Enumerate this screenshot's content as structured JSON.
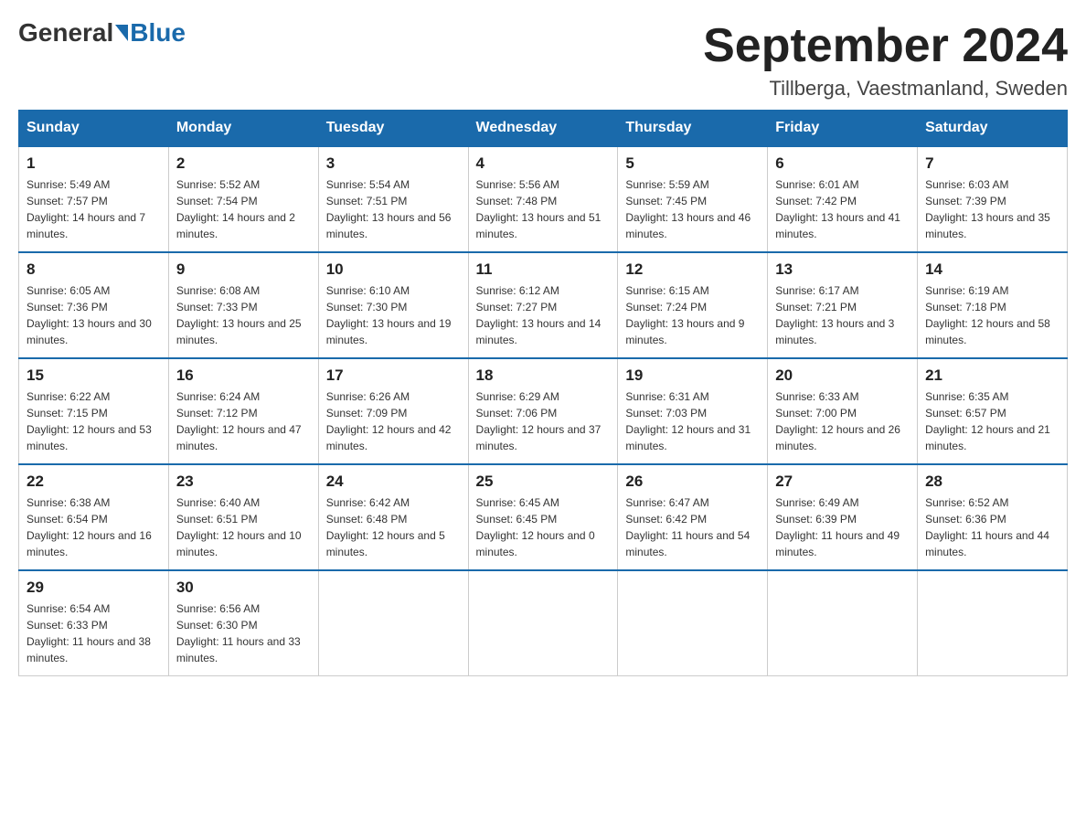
{
  "header": {
    "logo_general": "General",
    "logo_blue": "Blue",
    "month_title": "September 2024",
    "location": "Tillberga, Vaestmanland, Sweden"
  },
  "days_of_week": [
    "Sunday",
    "Monday",
    "Tuesday",
    "Wednesday",
    "Thursday",
    "Friday",
    "Saturday"
  ],
  "weeks": [
    [
      {
        "day": "1",
        "sunrise": "5:49 AM",
        "sunset": "7:57 PM",
        "daylight": "14 hours and 7 minutes."
      },
      {
        "day": "2",
        "sunrise": "5:52 AM",
        "sunset": "7:54 PM",
        "daylight": "14 hours and 2 minutes."
      },
      {
        "day": "3",
        "sunrise": "5:54 AM",
        "sunset": "7:51 PM",
        "daylight": "13 hours and 56 minutes."
      },
      {
        "day": "4",
        "sunrise": "5:56 AM",
        "sunset": "7:48 PM",
        "daylight": "13 hours and 51 minutes."
      },
      {
        "day": "5",
        "sunrise": "5:59 AM",
        "sunset": "7:45 PM",
        "daylight": "13 hours and 46 minutes."
      },
      {
        "day": "6",
        "sunrise": "6:01 AM",
        "sunset": "7:42 PM",
        "daylight": "13 hours and 41 minutes."
      },
      {
        "day": "7",
        "sunrise": "6:03 AM",
        "sunset": "7:39 PM",
        "daylight": "13 hours and 35 minutes."
      }
    ],
    [
      {
        "day": "8",
        "sunrise": "6:05 AM",
        "sunset": "7:36 PM",
        "daylight": "13 hours and 30 minutes."
      },
      {
        "day": "9",
        "sunrise": "6:08 AM",
        "sunset": "7:33 PM",
        "daylight": "13 hours and 25 minutes."
      },
      {
        "day": "10",
        "sunrise": "6:10 AM",
        "sunset": "7:30 PM",
        "daylight": "13 hours and 19 minutes."
      },
      {
        "day": "11",
        "sunrise": "6:12 AM",
        "sunset": "7:27 PM",
        "daylight": "13 hours and 14 minutes."
      },
      {
        "day": "12",
        "sunrise": "6:15 AM",
        "sunset": "7:24 PM",
        "daylight": "13 hours and 9 minutes."
      },
      {
        "day": "13",
        "sunrise": "6:17 AM",
        "sunset": "7:21 PM",
        "daylight": "13 hours and 3 minutes."
      },
      {
        "day": "14",
        "sunrise": "6:19 AM",
        "sunset": "7:18 PM",
        "daylight": "12 hours and 58 minutes."
      }
    ],
    [
      {
        "day": "15",
        "sunrise": "6:22 AM",
        "sunset": "7:15 PM",
        "daylight": "12 hours and 53 minutes."
      },
      {
        "day": "16",
        "sunrise": "6:24 AM",
        "sunset": "7:12 PM",
        "daylight": "12 hours and 47 minutes."
      },
      {
        "day": "17",
        "sunrise": "6:26 AM",
        "sunset": "7:09 PM",
        "daylight": "12 hours and 42 minutes."
      },
      {
        "day": "18",
        "sunrise": "6:29 AM",
        "sunset": "7:06 PM",
        "daylight": "12 hours and 37 minutes."
      },
      {
        "day": "19",
        "sunrise": "6:31 AM",
        "sunset": "7:03 PM",
        "daylight": "12 hours and 31 minutes."
      },
      {
        "day": "20",
        "sunrise": "6:33 AM",
        "sunset": "7:00 PM",
        "daylight": "12 hours and 26 minutes."
      },
      {
        "day": "21",
        "sunrise": "6:35 AM",
        "sunset": "6:57 PM",
        "daylight": "12 hours and 21 minutes."
      }
    ],
    [
      {
        "day": "22",
        "sunrise": "6:38 AM",
        "sunset": "6:54 PM",
        "daylight": "12 hours and 16 minutes."
      },
      {
        "day": "23",
        "sunrise": "6:40 AM",
        "sunset": "6:51 PM",
        "daylight": "12 hours and 10 minutes."
      },
      {
        "day": "24",
        "sunrise": "6:42 AM",
        "sunset": "6:48 PM",
        "daylight": "12 hours and 5 minutes."
      },
      {
        "day": "25",
        "sunrise": "6:45 AM",
        "sunset": "6:45 PM",
        "daylight": "12 hours and 0 minutes."
      },
      {
        "day": "26",
        "sunrise": "6:47 AM",
        "sunset": "6:42 PM",
        "daylight": "11 hours and 54 minutes."
      },
      {
        "day": "27",
        "sunrise": "6:49 AM",
        "sunset": "6:39 PM",
        "daylight": "11 hours and 49 minutes."
      },
      {
        "day": "28",
        "sunrise": "6:52 AM",
        "sunset": "6:36 PM",
        "daylight": "11 hours and 44 minutes."
      }
    ],
    [
      {
        "day": "29",
        "sunrise": "6:54 AM",
        "sunset": "6:33 PM",
        "daylight": "11 hours and 38 minutes."
      },
      {
        "day": "30",
        "sunrise": "6:56 AM",
        "sunset": "6:30 PM",
        "daylight": "11 hours and 33 minutes."
      },
      null,
      null,
      null,
      null,
      null
    ]
  ]
}
